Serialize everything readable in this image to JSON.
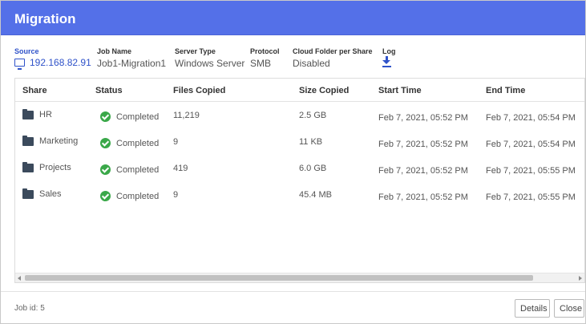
{
  "dialog": {
    "title": "Migration"
  },
  "info": {
    "source_label": "Source",
    "source_value": "192.168.82.91",
    "job_name_label": "Job Name",
    "job_name_value": "Job1-Migration1",
    "server_type_label": "Server Type",
    "server_type_value": "Windows Server",
    "protocol_label": "Protocol",
    "protocol_value": "SMB",
    "cloud_folder_label": "Cloud Folder per Share",
    "cloud_folder_value": "Disabled",
    "log_label": "Log"
  },
  "table": {
    "columns": {
      "share": "Share",
      "status": "Status",
      "files_copied": "Files Copied",
      "size_copied": "Size Copied",
      "start_time": "Start Time",
      "end_time": "End Time"
    },
    "rows": [
      {
        "share": "HR",
        "status": "Completed",
        "files_copied": "11,219",
        "size_copied": "2.5 GB",
        "start_time": "Feb 7, 2021, 05:52 PM",
        "end_time": "Feb 7, 2021, 05:54 PM"
      },
      {
        "share": "Marketing",
        "status": "Completed",
        "files_copied": "9",
        "size_copied": "11 KB",
        "start_time": "Feb 7, 2021, 05:52 PM",
        "end_time": "Feb 7, 2021, 05:54 PM"
      },
      {
        "share": "Projects",
        "status": "Completed",
        "files_copied": "419",
        "size_copied": "6.0 GB",
        "start_time": "Feb 7, 2021, 05:52 PM",
        "end_time": "Feb 7, 2021, 05:55 PM"
      },
      {
        "share": "Sales",
        "status": "Completed",
        "files_copied": "9",
        "size_copied": "45.4 MB",
        "start_time": "Feb 7, 2021, 05:52 PM",
        "end_time": "Feb 7, 2021, 05:55 PM"
      }
    ]
  },
  "footer": {
    "job_id": "Job id: 5",
    "details_label": "Details",
    "close_label": "Close"
  },
  "colors": {
    "header_bg": "#5470e8",
    "link": "#2f52c9",
    "status_ok": "#3aa849",
    "folder": "#3b4a5c"
  },
  "icons": {
    "source": "monitor-icon",
    "log": "download-icon",
    "share": "folder-icon",
    "status": "check-circle-icon"
  }
}
